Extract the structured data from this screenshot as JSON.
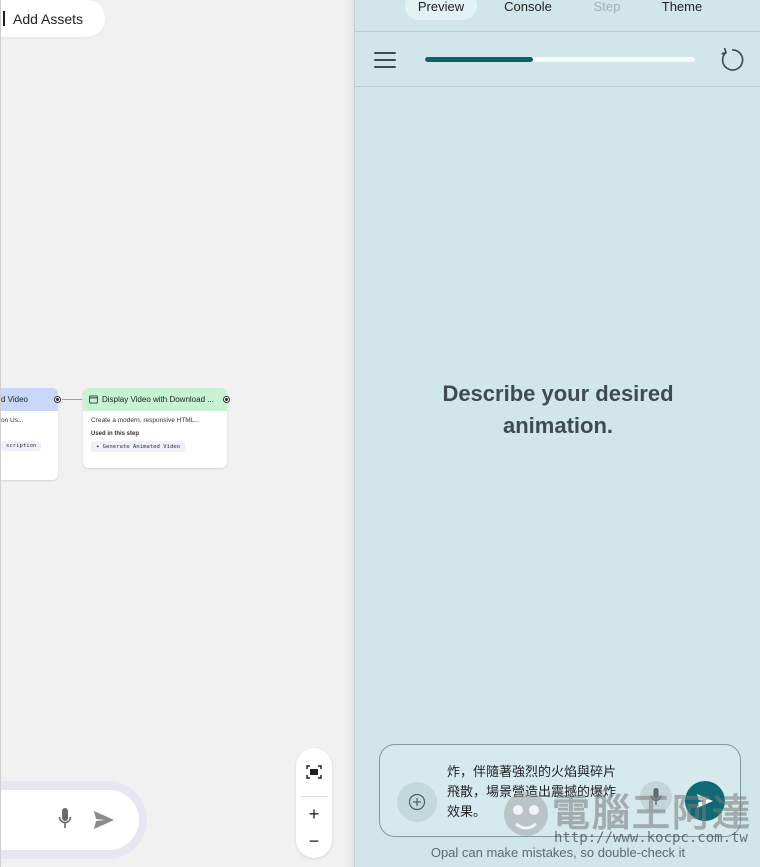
{
  "canvas": {
    "add_assets_label": "Add Assets",
    "nodes": [
      {
        "title": "d Video",
        "desc": "on Us...",
        "chip": "scription",
        "header_color": "#c9d7fa"
      },
      {
        "title": "Display Video with Download ...",
        "desc": "Create a modern, responsive HTML...",
        "used_label": "Used in this step",
        "chip": "Generate Animated Video",
        "header_color": "#c8f2d4"
      }
    ],
    "zoom": {
      "fit_icon": "fit-screen-icon",
      "zoom_in_label": "+",
      "zoom_out_label": "−"
    }
  },
  "panel": {
    "tabs": [
      {
        "label": "Preview",
        "state": "active"
      },
      {
        "label": "Console",
        "state": "normal"
      },
      {
        "label": "Step",
        "state": "disabled"
      },
      {
        "label": "Theme",
        "state": "normal"
      }
    ],
    "progress_fraction": 0.4,
    "prompt_line1": "Describe your desired",
    "prompt_line2": "animation.",
    "chat_input_text": "炸，伴隨著強烈的火焰與碎片飛散，場景營造出震撼的爆炸效果。",
    "disclaimer": "Opal can make mistakes, so double-check it"
  },
  "watermark": {
    "text": "電腦王阿達",
    "url": "http://www.kocpc.com.tw"
  },
  "colors": {
    "panel_bg": "#d0e6eb",
    "accent": "#0f5f69",
    "send_button": "#0f6b73"
  }
}
